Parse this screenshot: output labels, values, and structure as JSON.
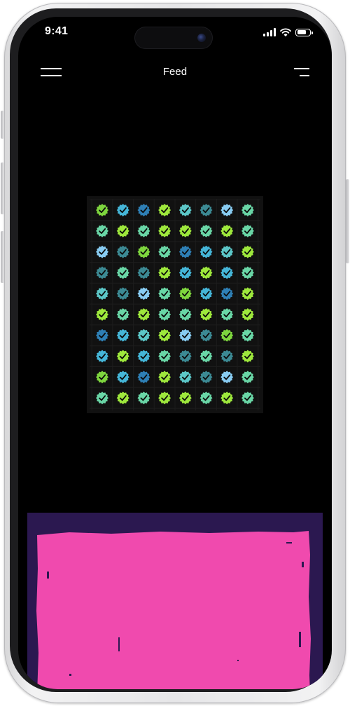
{
  "status_bar": {
    "time": "9:41",
    "icons": [
      "signal-icon",
      "wifi-icon",
      "battery-icon"
    ],
    "battery_level": 0.8
  },
  "header": {
    "title": "Feed",
    "left_icon": "menu-icon",
    "right_icon": "filter-icon"
  },
  "feed": {
    "items": [
      {
        "type": "artwork",
        "name": "checks-grid",
        "background": "#111111",
        "grid_columns": 8,
        "grid_rows": 10,
        "icon": "check-badge-icon",
        "palette": [
          "#7ed63e",
          "#9ee83c",
          "#88ccf2",
          "#45b6d8",
          "#5cc7c8",
          "#69d6a6",
          "#2e7fb5",
          "#3c8a94"
        ]
      },
      {
        "type": "artwork",
        "name": "pink-painting",
        "background": "#2b1850",
        "fill": "#f04aae"
      }
    ]
  }
}
